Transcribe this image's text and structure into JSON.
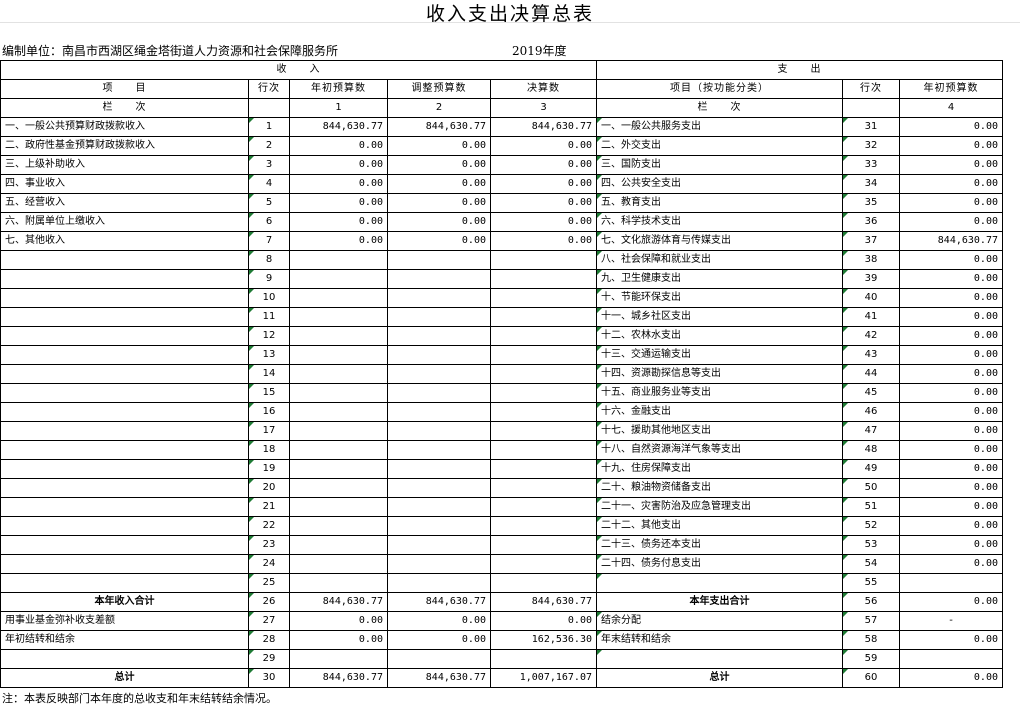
{
  "title": "收入支出决算总表",
  "unit_label": "编制单位：南昌市西湖区绳金塔街道人力资源和社会保障服务所",
  "year": "2019年度",
  "headers": {
    "income_group": "收　　入",
    "expense_group": "支　　出",
    "item": "项　　目",
    "line": "行次",
    "col_init": "年初预算数",
    "col_adj": "调整预算数",
    "col_final": "决算数",
    "expense_item": "项目（按功能分类）",
    "col_exp_init": "年初预算数",
    "order": "栏　　次",
    "n1": "1",
    "n2": "2",
    "n3": "3",
    "n4": "4"
  },
  "rows": [
    {
      "left": "一、一般公共预算财政拨款收入",
      "line": "1",
      "v1": "844,630.77",
      "v2": "844,630.77",
      "v3": "844,630.77",
      "right": "一、一般公共服务支出",
      "rline": "31",
      "r1": "0.00"
    },
    {
      "left": "二、政府性基金预算财政拨款收入",
      "line": "2",
      "v1": "0.00",
      "v2": "0.00",
      "v3": "0.00",
      "right": "二、外交支出",
      "rline": "32",
      "r1": "0.00"
    },
    {
      "left": "三、上级补助收入",
      "line": "3",
      "v1": "0.00",
      "v2": "0.00",
      "v3": "0.00",
      "right": "三、国防支出",
      "rline": "33",
      "r1": "0.00"
    },
    {
      "left": "四、事业收入",
      "line": "4",
      "v1": "0.00",
      "v2": "0.00",
      "v3": "0.00",
      "right": "四、公共安全支出",
      "rline": "34",
      "r1": "0.00"
    },
    {
      "left": "五、经营收入",
      "line": "5",
      "v1": "0.00",
      "v2": "0.00",
      "v3": "0.00",
      "right": "五、教育支出",
      "rline": "35",
      "r1": "0.00"
    },
    {
      "left": "六、附属单位上缴收入",
      "line": "6",
      "v1": "0.00",
      "v2": "0.00",
      "v3": "0.00",
      "right": "六、科学技术支出",
      "rline": "36",
      "r1": "0.00"
    },
    {
      "left": "七、其他收入",
      "line": "7",
      "v1": "0.00",
      "v2": "0.00",
      "v3": "0.00",
      "right": "七、文化旅游体育与传媒支出",
      "rline": "37",
      "r1": "844,630.77"
    },
    {
      "left": "",
      "line": "8",
      "v1": "",
      "v2": "",
      "v3": "",
      "right": "八、社会保障和就业支出",
      "rline": "38",
      "r1": "0.00"
    },
    {
      "left": "",
      "line": "9",
      "v1": "",
      "v2": "",
      "v3": "",
      "right": "九、卫生健康支出",
      "rline": "39",
      "r1": "0.00"
    },
    {
      "left": "",
      "line": "10",
      "v1": "",
      "v2": "",
      "v3": "",
      "right": "十、节能环保支出",
      "rline": "40",
      "r1": "0.00"
    },
    {
      "left": "",
      "line": "11",
      "v1": "",
      "v2": "",
      "v3": "",
      "right": "十一、城乡社区支出",
      "rline": "41",
      "r1": "0.00"
    },
    {
      "left": "",
      "line": "12",
      "v1": "",
      "v2": "",
      "v3": "",
      "right": "十二、农林水支出",
      "rline": "42",
      "r1": "0.00"
    },
    {
      "left": "",
      "line": "13",
      "v1": "",
      "v2": "",
      "v3": "",
      "right": "十三、交通运输支出",
      "rline": "43",
      "r1": "0.00"
    },
    {
      "left": "",
      "line": "14",
      "v1": "",
      "v2": "",
      "v3": "",
      "right": "十四、资源勘探信息等支出",
      "rline": "44",
      "r1": "0.00"
    },
    {
      "left": "",
      "line": "15",
      "v1": "",
      "v2": "",
      "v3": "",
      "right": "十五、商业服务业等支出",
      "rline": "45",
      "r1": "0.00"
    },
    {
      "left": "",
      "line": "16",
      "v1": "",
      "v2": "",
      "v3": "",
      "right": "十六、金融支出",
      "rline": "46",
      "r1": "0.00"
    },
    {
      "left": "",
      "line": "17",
      "v1": "",
      "v2": "",
      "v3": "",
      "right": "十七、援助其他地区支出",
      "rline": "47",
      "r1": "0.00"
    },
    {
      "left": "",
      "line": "18",
      "v1": "",
      "v2": "",
      "v3": "",
      "right": "十八、自然资源海洋气象等支出",
      "rline": "48",
      "r1": "0.00"
    },
    {
      "left": "",
      "line": "19",
      "v1": "",
      "v2": "",
      "v3": "",
      "right": "十九、住房保障支出",
      "rline": "49",
      "r1": "0.00"
    },
    {
      "left": "",
      "line": "20",
      "v1": "",
      "v2": "",
      "v3": "",
      "right": "二十、粮油物资储备支出",
      "rline": "50",
      "r1": "0.00"
    },
    {
      "left": "",
      "line": "21",
      "v1": "",
      "v2": "",
      "v3": "",
      "right": "二十一、灾害防治及应急管理支出",
      "rline": "51",
      "r1": "0.00"
    },
    {
      "left": "",
      "line": "22",
      "v1": "",
      "v2": "",
      "v3": "",
      "right": "二十二、其他支出",
      "rline": "52",
      "r1": "0.00"
    },
    {
      "left": "",
      "line": "23",
      "v1": "",
      "v2": "",
      "v3": "",
      "right": "二十三、债务还本支出",
      "rline": "53",
      "r1": "0.00"
    },
    {
      "left": "",
      "line": "24",
      "v1": "",
      "v2": "",
      "v3": "",
      "right": "二十四、债务付息支出",
      "rline": "54",
      "r1": "0.00"
    },
    {
      "left": "",
      "line": "25",
      "v1": "",
      "v2": "",
      "v3": "",
      "right": "",
      "rline": "55",
      "r1": ""
    },
    {
      "left": "本年收入合计",
      "line": "26",
      "v1": "844,630.77",
      "v2": "844,630.77",
      "v3": "844,630.77",
      "right": "本年支出合计",
      "rline": "56",
      "r1": "0.00",
      "bold": true
    },
    {
      "left": "用事业基金弥补收支差额",
      "line": "27",
      "v1": "0.00",
      "v2": "0.00",
      "v3": "0.00",
      "right": "结余分配",
      "rline": "57",
      "r1": "-"
    },
    {
      "left": "年初结转和结余",
      "line": "28",
      "v1": "0.00",
      "v2": "0.00",
      "v3": "162,536.30",
      "right": "年末结转和结余",
      "rline": "58",
      "r1": "0.00"
    },
    {
      "left": "",
      "line": "29",
      "v1": "",
      "v2": "",
      "v3": "",
      "right": "",
      "rline": "59",
      "r1": ""
    },
    {
      "left": "总计",
      "line": "30",
      "v1": "844,630.77",
      "v2": "844,630.77",
      "v3": "1,007,167.07",
      "right": "总计",
      "rline": "60",
      "r1": "0.00",
      "bold": true
    }
  ],
  "note": "注：本表反映部门本年度的总收支和年末结转结余情况。"
}
